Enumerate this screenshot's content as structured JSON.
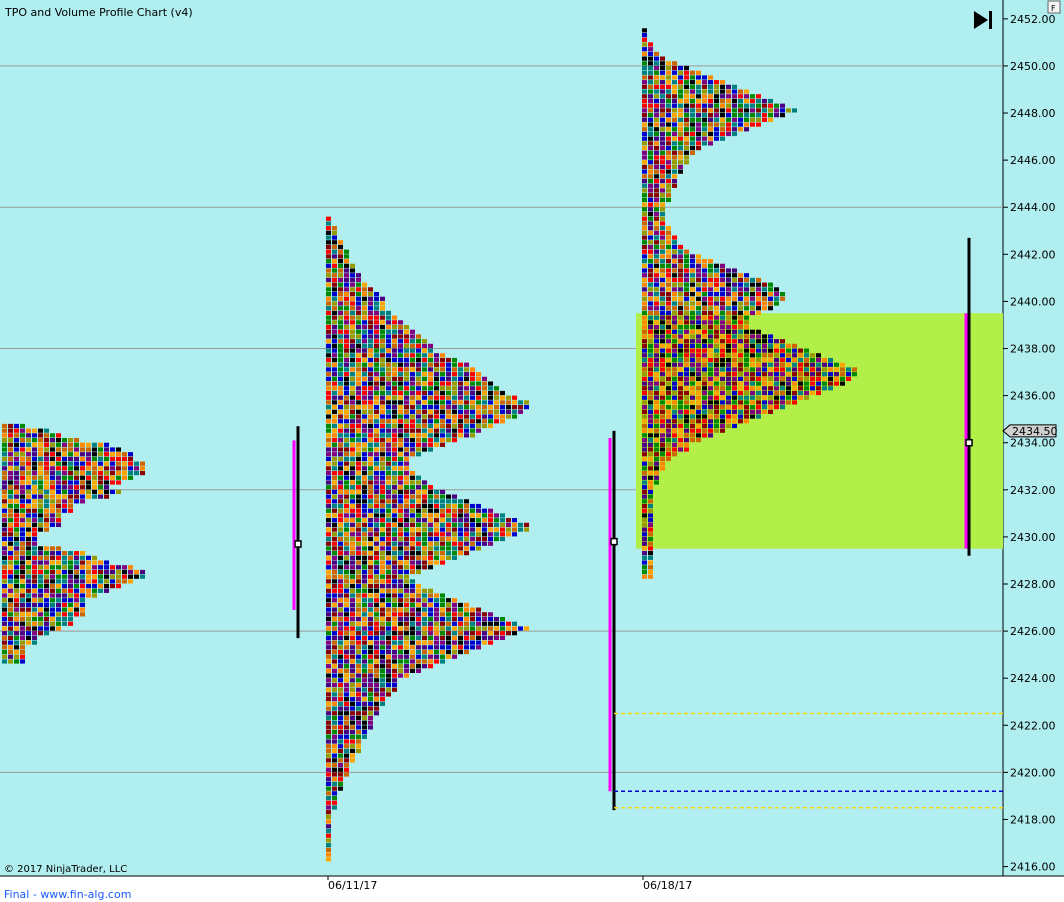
{
  "window": {
    "title": "TPO and Volume Profile Chart (v4)",
    "copyright": "© 2017 NinjaTrader, LLC",
    "footer_link": "Final - www.fin-alg.com",
    "corner_button": "F"
  },
  "colors": {
    "background": "#b0eef0",
    "grid": "#9a9a9a",
    "value_area": "#b3ef49",
    "poc_bracket": "#ff00ff",
    "range_bracket": "#000000",
    "vwap_line": "#f0a0ff",
    "ib_red": "#ff0000",
    "ib_yellow": "#ffff00",
    "ib_green": "#228b22"
  },
  "icons": {
    "scroll_end": "play-to-end-icon"
  },
  "chart_data": {
    "type": "tpo-profile",
    "title": "TPO and Volume Profile Chart (v4)",
    "ylim": [
      2415.6,
      2452.8
    ],
    "tick_step": 2,
    "y_ticks": [
      "2416.00",
      "2418.00",
      "2420.00",
      "2422.00",
      "2424.00",
      "2426.00",
      "2428.00",
      "2430.00",
      "2432.00",
      "2434.00",
      "2436.00",
      "2438.00",
      "2440.00",
      "2442.00",
      "2444.00",
      "2446.00",
      "2448.00",
      "2450.00",
      "2452.00"
    ],
    "x_labels": [
      "06/11/17",
      "06/18/17"
    ],
    "last_price": "2434.50",
    "grid": true,
    "value_area_current": {
      "low": 2429.5,
      "high": 2439.5
    },
    "levels": [
      {
        "price": 2422.5,
        "style": "dashed",
        "color": "#ffd700"
      },
      {
        "price": 2419.2,
        "style": "dashed",
        "color": "#0000cc"
      },
      {
        "price": 2418.5,
        "style": "dashed",
        "color": "#ffd700"
      }
    ],
    "profiles": [
      {
        "session": "prior",
        "top": 2434.8,
        "rows": 51,
        "row_h": 0.2,
        "widths": [
          4,
          8,
          10,
          13,
          18,
          20,
          22,
          22,
          24,
          24,
          24,
          22,
          20,
          18,
          20,
          18,
          14,
          12,
          12,
          10,
          10,
          10,
          8,
          6,
          6,
          6,
          10,
          14,
          16,
          18,
          22,
          24,
          24,
          22,
          20,
          18,
          16,
          14,
          14,
          14,
          14,
          12,
          12,
          10,
          8,
          6,
          6,
          4,
          4,
          4,
          4
        ],
        "range": [
          2425.7,
          2434.7
        ],
        "poc": 2429.7,
        "va": [
          2426.9,
          2434.1
        ]
      },
      {
        "session": "06/11/17",
        "top": 2443.6,
        "rows": 137,
        "row_h": 0.2,
        "widths": [
          1,
          1,
          2,
          2,
          2,
          3,
          3,
          4,
          4,
          4,
          5,
          5,
          6,
          6,
          7,
          8,
          9,
          10,
          10,
          10,
          11,
          12,
          13,
          14,
          15,
          16,
          17,
          18,
          18,
          20,
          22,
          24,
          25,
          26,
          27,
          28,
          29,
          30,
          32,
          34,
          34,
          33,
          32,
          30,
          28,
          26,
          25,
          22,
          20,
          18,
          16,
          14,
          14,
          14,
          15,
          16,
          17,
          18,
          20,
          22,
          24,
          26,
          28,
          30,
          32,
          34,
          34,
          32,
          30,
          28,
          26,
          24,
          22,
          20,
          18,
          16,
          14,
          15,
          16,
          18,
          20,
          22,
          24,
          26,
          28,
          30,
          32,
          34,
          32,
          30,
          28,
          26,
          24,
          22,
          20,
          18,
          16,
          14,
          12,
          12,
          12,
          11,
          10,
          10,
          9,
          9,
          8,
          8,
          8,
          7,
          7,
          6,
          6,
          6,
          5,
          5,
          4,
          4,
          4,
          3,
          3,
          3,
          2,
          2,
          2,
          2,
          1,
          1,
          1,
          1,
          1,
          1,
          1,
          1,
          1,
          1,
          1
        ],
        "range": [
          2418.4,
          2434.5
        ],
        "poc": 2429.8,
        "va": [
          2419.2,
          2434.2
        ]
      },
      {
        "session": "06/18/17",
        "top": 2451.6,
        "rows": 117,
        "row_h": 0.2,
        "widths": [
          1,
          1,
          1,
          2,
          2,
          3,
          4,
          6,
          8,
          10,
          12,
          14,
          16,
          18,
          20,
          22,
          24,
          26,
          24,
          22,
          20,
          18,
          16,
          14,
          12,
          10,
          9,
          8,
          8,
          7,
          7,
          6,
          6,
          6,
          5,
          5,
          5,
          4,
          4,
          4,
          4,
          4,
          5,
          5,
          6,
          6,
          7,
          8,
          10,
          12,
          14,
          16,
          18,
          20,
          22,
          23,
          24,
          24,
          23,
          22,
          20,
          18,
          18,
          18,
          20,
          22,
          24,
          26,
          28,
          30,
          32,
          34,
          36,
          36,
          35,
          34,
          32,
          30,
          28,
          26,
          24,
          22,
          20,
          18,
          16,
          14,
          12,
          10,
          8,
          8,
          6,
          5,
          4,
          4,
          3,
          3,
          3,
          2,
          2,
          2,
          2,
          2,
          2,
          2,
          2,
          2,
          2,
          2,
          2,
          2,
          2,
          2,
          2,
          2,
          2,
          2,
          2
        ],
        "range": [
          2429.2,
          2442.7
        ],
        "poc": 2434.0,
        "va": [
          2429.5,
          2439.5
        ]
      }
    ]
  }
}
